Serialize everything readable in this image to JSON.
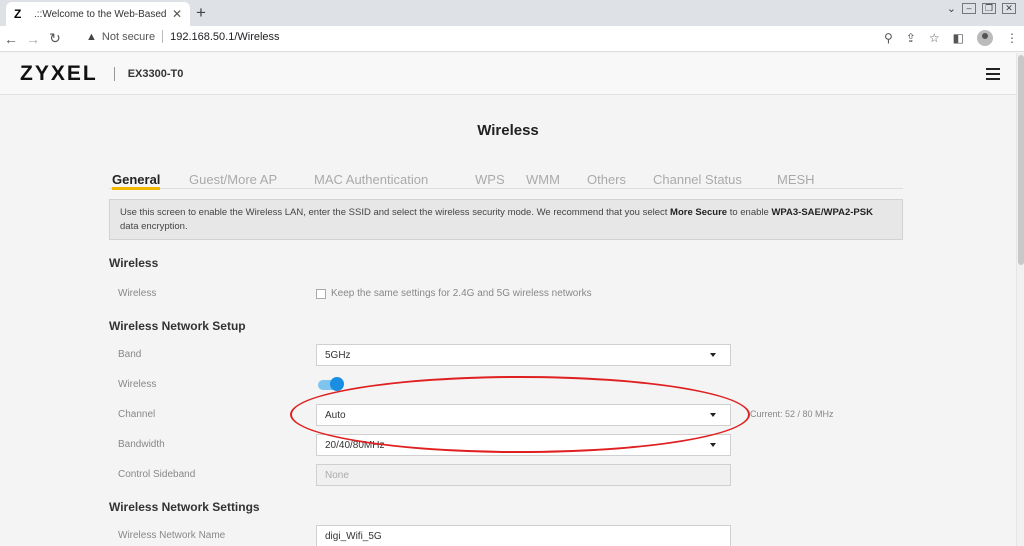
{
  "browser": {
    "tab_favicon": "Z",
    "tab_title": ".::Welcome to the Web-Based Configurator::.",
    "tab_close": "✕",
    "new_tab": "+",
    "not_secure": "Not secure",
    "url": "192.168.50.1/Wireless",
    "icons": [
      "back-icon",
      "forward-icon",
      "reload-icon",
      "warning-icon",
      "zoom-icon",
      "share-icon",
      "star-icon",
      "sidebar-icon",
      "profile-icon",
      "menu-kebab-icon"
    ]
  },
  "header": {
    "logo": "ZYXEL",
    "model": "EX3300-T0"
  },
  "page": {
    "title": "Wireless",
    "tabs": [
      {
        "label": "General",
        "active": true
      },
      {
        "label": "Guest/More AP"
      },
      {
        "label": "MAC Authentication"
      },
      {
        "label": "WPS"
      },
      {
        "label": "WMM"
      },
      {
        "label": "Others"
      },
      {
        "label": "Channel Status"
      },
      {
        "label": "MESH"
      }
    ],
    "info": {
      "part1": "Use this screen to enable the Wireless LAN, enter the SSID and select the wireless security mode. We recommend that you select ",
      "bold1": "More Secure",
      "part2": " to enable ",
      "bold2": "WPA3-SAE/WPA2-PSK",
      "part3": " data encryption."
    },
    "sections": {
      "wireless": "Wireless",
      "setup": "Wireless Network Setup",
      "settings": "Wireless Network Settings"
    },
    "fields": {
      "wireless_label": "Wireless",
      "keep_same": "Keep the same settings for 2.4G and 5G wireless networks",
      "band_label": "Band",
      "band_value": "5GHz",
      "wireless2_label": "Wireless",
      "wireless_enabled": true,
      "channel_label": "Channel",
      "channel_value": "Auto",
      "channel_current": "Current: 52 / 80 MHz",
      "bandwidth_label": "Bandwidth",
      "bandwidth_value": "20/40/80MHz",
      "sideband_label": "Control Sideband",
      "sideband_value": "None",
      "ssid_label": "Wireless Network Name",
      "ssid_value": "digi_Wifi_5G"
    },
    "annotation_color": "#e02020",
    "accent": "#f2b800"
  }
}
